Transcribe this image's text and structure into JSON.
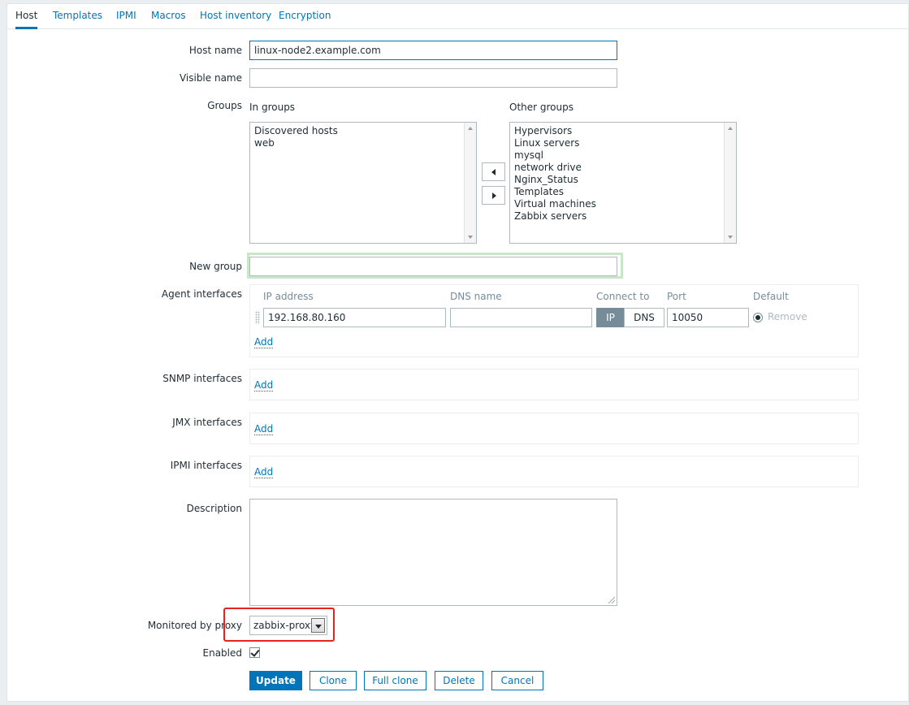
{
  "tabs": [
    "Host",
    "Templates",
    "IPMI",
    "Macros",
    "Host inventory",
    "Encryption"
  ],
  "active_tab": "Host",
  "labels": {
    "host_name": "Host name",
    "visible_name": "Visible name",
    "groups": "Groups",
    "in_groups": "In groups",
    "other_groups": "Other groups",
    "new_group": "New group",
    "agent_interfaces": "Agent interfaces",
    "snmp_interfaces": "SNMP interfaces",
    "jmx_interfaces": "JMX interfaces",
    "ipmi_interfaces": "IPMI interfaces",
    "description": "Description",
    "monitored_by_proxy": "Monitored by proxy",
    "enabled": "Enabled"
  },
  "fields": {
    "host_name": "linux-node2.example.com",
    "visible_name": "",
    "new_group": "",
    "description": ""
  },
  "in_groups": [
    "Discovered hosts",
    "web"
  ],
  "other_groups": [
    "Hypervisors",
    "Linux servers",
    "mysql",
    "network drive",
    "Nginx_Status",
    "Templates",
    "Virtual machines",
    "Zabbix servers"
  ],
  "interface_columns": {
    "ip": "IP address",
    "dns": "DNS name",
    "connect_to": "Connect to",
    "port": "Port",
    "default": "Default"
  },
  "agent_interface": {
    "ip": "192.168.80.160",
    "dns": "",
    "connect_ip": "IP",
    "connect_dns": "DNS",
    "port": "10050",
    "remove": "Remove"
  },
  "add_link": "Add",
  "proxy": {
    "selected": "zabbix-proxy"
  },
  "enabled": true,
  "buttons": {
    "update": "Update",
    "clone": "Clone",
    "full_clone": "Full clone",
    "delete": "Delete",
    "cancel": "Cancel"
  },
  "colors": {
    "accent": "#0275b8",
    "highlight": "#e5241e",
    "new_group_glow": "#c8e6c9"
  }
}
